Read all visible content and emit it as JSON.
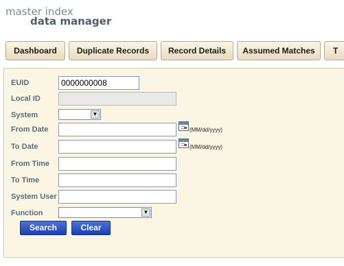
{
  "logo": {
    "line1": "master index",
    "line2": "data manager"
  },
  "tabs": [
    "Dashboard",
    "Duplicate Records",
    "Record Details",
    "Assumed Matches",
    "T"
  ],
  "form": {
    "euid": {
      "label": "EUID",
      "value": "0000000008"
    },
    "local_id": {
      "label": "Local ID",
      "value": ""
    },
    "system": {
      "label": "System",
      "value": ""
    },
    "from_date": {
      "label": "From Date",
      "value": "",
      "hint": "(MM/dd/yyyy)"
    },
    "to_date": {
      "label": "To Date",
      "value": "",
      "hint": "(MM/dd/yyyy)"
    },
    "from_time": {
      "label": "From Time",
      "value": ""
    },
    "to_time": {
      "label": "To Time",
      "value": ""
    },
    "system_user": {
      "label": "System User",
      "value": ""
    },
    "function": {
      "label": "Function",
      "value": ""
    }
  },
  "buttons": {
    "search": "Search",
    "clear": "Clear"
  },
  "colors": {
    "panel_bg": "#fbf5e4",
    "label": "#5a6b7b",
    "button": "#2a4fc3"
  },
  "icons": [
    "calendar-icon",
    "chevron-down-icon"
  ]
}
